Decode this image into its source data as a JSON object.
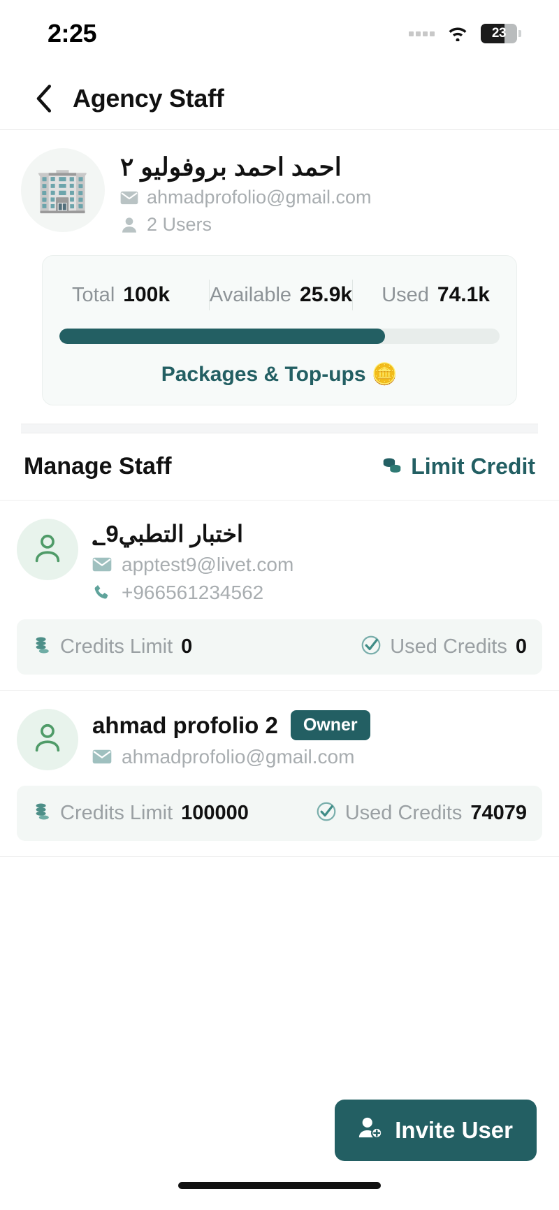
{
  "status_bar": {
    "time": "2:25",
    "wifi_icon": "wifi-icon",
    "battery_level": "23"
  },
  "nav": {
    "back_icon": "chevron-left-icon",
    "title": "Agency Staff"
  },
  "agency": {
    "avatar_emoji": "🏢",
    "name": "احمد احمد بروفوليو ٢",
    "email": "ahmadprofolio@gmail.com",
    "users_count": "2 Users",
    "email_icon": "envelope-icon",
    "users_icon": "person-icon"
  },
  "credit": {
    "total_label": "Total",
    "total_value": "100k",
    "available_label": "Available",
    "available_value": "25.9k",
    "used_label": "Used",
    "used_value": "74.1k",
    "progress_percent": 74,
    "packages_label": "Packages & Top-ups 🪙",
    "bar_color": "#235f63",
    "track_color": "#e8edeb"
  },
  "manage": {
    "title": "Manage Staff",
    "limit_credit_label": "Limit Credit",
    "limit_credit_icon": "coins-icon"
  },
  "staff": [
    {
      "name": "اختبار التطبي؂9",
      "email": "apptest9@livet.com",
      "phone": "+966561234562",
      "credits_limit_label": "Credits Limit",
      "credits_limit_value": "0",
      "used_credits_label": "Used Credits",
      "used_credits_value": "0",
      "badge": ""
    },
    {
      "name": "ahmad profolio 2",
      "email": "ahmadprofolio@gmail.com",
      "phone": "",
      "credits_limit_label": "Credits Limit",
      "credits_limit_value": "100000",
      "used_credits_label": "Used Credits",
      "used_credits_value": "74079",
      "badge": "Owner"
    }
  ],
  "footer": {
    "invite_label": "Invite User",
    "invite_icon": "person-add-icon"
  },
  "theme": {
    "accent": "#235f63",
    "avatar_green": "#4f9b68",
    "muted": "#a8adb0"
  }
}
